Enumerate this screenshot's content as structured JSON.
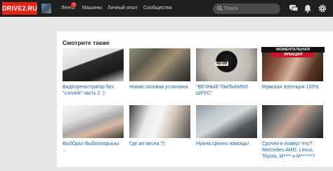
{
  "header": {
    "logo": "DRIVE2.RU",
    "nav": [
      {
        "label": "Лента",
        "badge": "9"
      },
      {
        "label": "Машины"
      },
      {
        "label": "Личный опыт"
      },
      {
        "label": "Сообщества"
      }
    ],
    "search": {
      "placeholder": "Поиск"
    },
    "icons": [
      "chat-icon",
      "bell-icon",
      "gear-icon"
    ]
  },
  "panel": {
    "title": "Смотрите также",
    "cards": [
      {
        "title": "Видеорегистратор без \"соплей\" часть 2 :)"
      },
      {
        "title": "Новая силовая установка"
      },
      {
        "title": "\"ВЕЧНЫЕ ПЫЛЬНИКИ ШРУС\""
      },
      {
        "title": "Мужская потенция 100%"
      },
      {
        "title": "ВыбОры! Выбоооорыыы ..."
      },
      {
        "title": "Где же весна ?)"
      },
      {
        "title": "Нужна срочно помощь!"
      },
      {
        "title": "Срочно в номер! Что? Mercedes-AMG, Lexus, Toyota, M**** и M******?"
      }
    ],
    "image_labels": {
      "jar": "40-00",
      "promo_line1": "МОМЕНТАЛЬНАЯ",
      "promo_line2": "ЭРЕКЦИЯ"
    }
  },
  "colors": {
    "topbar": "#1e1e1e",
    "logo": "#e1251b",
    "link": "#1c64b3",
    "page_bg": "#e8e8e8"
  }
}
